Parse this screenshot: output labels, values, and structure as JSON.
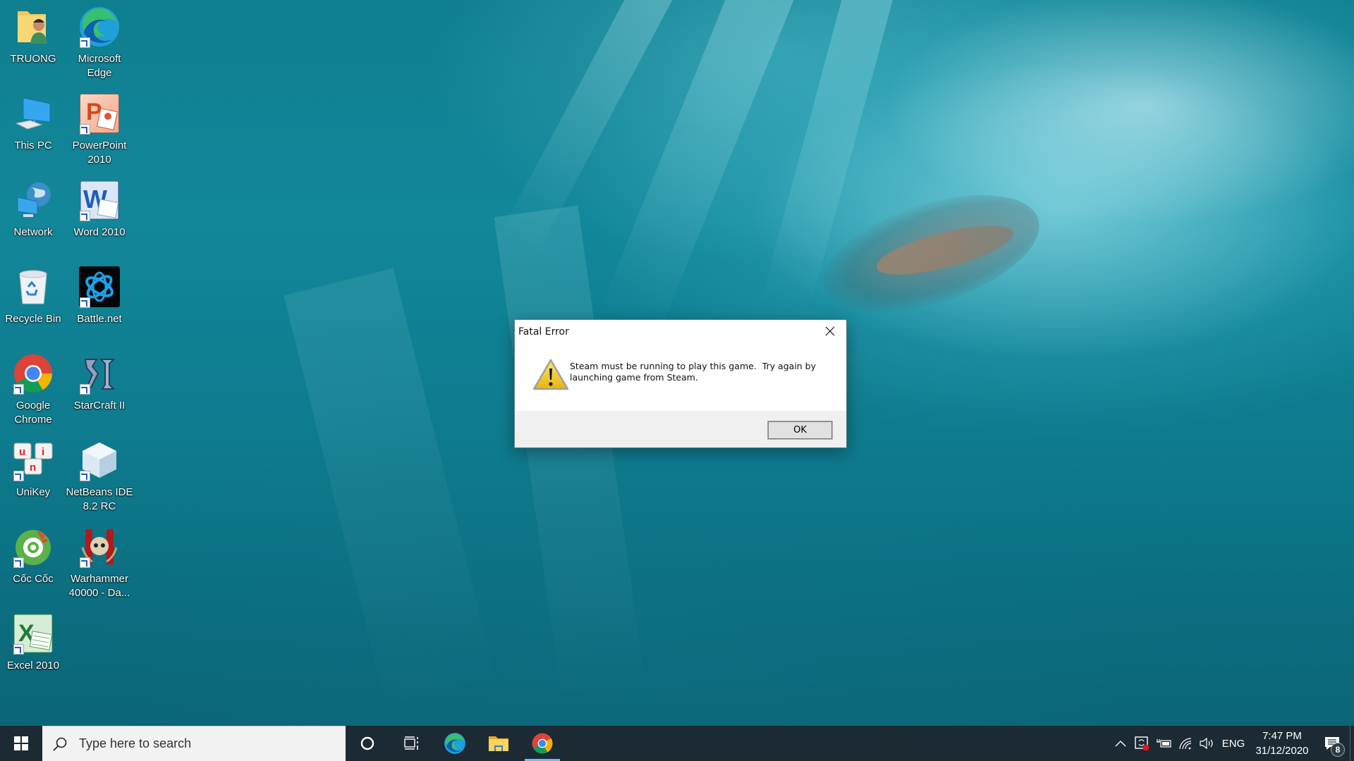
{
  "desktop": {
    "icons": [
      {
        "label": "TRUONG",
        "icon": "user-folder-icon",
        "shortcut": false
      },
      {
        "label": "Microsoft Edge",
        "icon": "edge-icon",
        "shortcut": true
      },
      {
        "label": "This PC",
        "icon": "computer-icon",
        "shortcut": false
      },
      {
        "label": "PowerPoint 2010",
        "icon": "powerpoint-icon",
        "shortcut": true
      },
      {
        "label": "Network",
        "icon": "network-icon",
        "shortcut": false
      },
      {
        "label": "Word 2010",
        "icon": "word-icon",
        "shortcut": true
      },
      {
        "label": "Recycle Bin",
        "icon": "recycle-bin-icon",
        "shortcut": false
      },
      {
        "label": "Battle.net",
        "icon": "battlenet-icon",
        "shortcut": true
      },
      {
        "label": "Google Chrome",
        "icon": "chrome-icon",
        "shortcut": true
      },
      {
        "label": "StarCraft II",
        "icon": "starcraft-icon",
        "shortcut": true
      },
      {
        "label": "UniKey",
        "icon": "unikey-icon",
        "shortcut": true
      },
      {
        "label": "NetBeans IDE 8.2 RC",
        "icon": "netbeans-icon",
        "shortcut": true
      },
      {
        "label": "Cốc Cốc",
        "icon": "coccoc-icon",
        "shortcut": true
      },
      {
        "label": "Warhammer 40000 - Da...",
        "icon": "warhammer-icon",
        "shortcut": true
      },
      {
        "label": "Excel 2010",
        "icon": "excel-icon",
        "shortcut": true
      }
    ]
  },
  "dialog": {
    "title": "Fatal Error",
    "icon": "warning-icon",
    "message": "Steam must be running to play this game.  Try again by\nlaunching game from Steam.",
    "ok_label": "OK"
  },
  "taskbar": {
    "search_placeholder": "Type here to search",
    "pinned": [
      {
        "name": "cortana",
        "icon": "cortana-icon",
        "active": false
      },
      {
        "name": "task-view",
        "icon": "task-view-icon",
        "active": false
      },
      {
        "name": "edge",
        "icon": "edge-icon",
        "active": false
      },
      {
        "name": "file-explorer",
        "icon": "file-explorer-icon",
        "active": false
      },
      {
        "name": "chrome",
        "icon": "chrome-icon",
        "active": true
      }
    ],
    "tray": {
      "language": "ENG",
      "time": "7:47 PM",
      "date": "31/12/2020",
      "notification_count": "8"
    }
  },
  "colors": {
    "taskbar_bg": "#1b2a33",
    "active_indicator": "#76b9ed",
    "dialog_footer": "#f0f0f0"
  }
}
